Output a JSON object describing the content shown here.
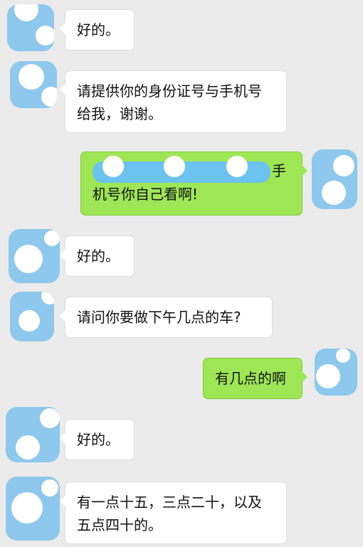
{
  "colors": {
    "background": "#ebebeb",
    "incoming_bubble": "#ffffff",
    "outgoing_bubble": "#9ee656",
    "avatar_mask": "#8ec8ec"
  },
  "messages": [
    {
      "side": "incoming",
      "text": "好的。"
    },
    {
      "side": "incoming",
      "text": "请提供你的身份证号与手机号给我，谢谢。"
    },
    {
      "side": "outgoing",
      "text_after_redaction": "手机号你自己看啊!"
    },
    {
      "side": "incoming",
      "text": "好的。"
    },
    {
      "side": "incoming",
      "text": "请问你要做下午几点的车?"
    },
    {
      "side": "outgoing",
      "text": "有几点的啊"
    },
    {
      "side": "incoming",
      "text": "好的。"
    },
    {
      "side": "incoming",
      "text": "有一点十五，三点二十，以及五点四十的。"
    }
  ],
  "icons": {
    "avatar": "avatar-icon"
  }
}
